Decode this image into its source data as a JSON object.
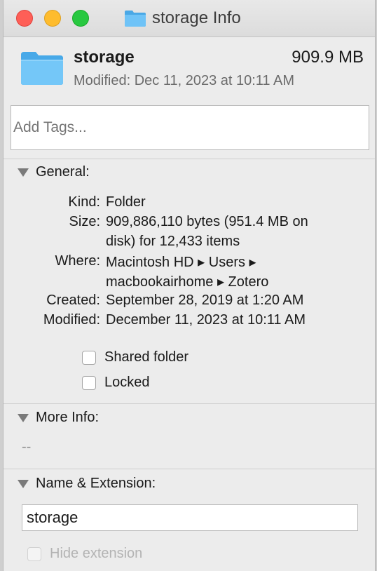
{
  "window": {
    "title": "storage Info"
  },
  "header": {
    "name": "storage",
    "size": "909.9 MB",
    "modified": "Modified: Dec 11, 2023 at 10:11 AM"
  },
  "tags": {
    "placeholder": "Add Tags..."
  },
  "general": {
    "title": "General:",
    "rows": [
      {
        "label": "Kind:",
        "value": "Folder"
      },
      {
        "label": "Size:",
        "value": "909,886,110 bytes (951.4 MB on",
        "value2": "disk) for 12,433 items"
      },
      {
        "label": "Where:",
        "value": "Macintosh HD ▸ Users ▸",
        "value2": "macbookairhome ▸ Zotero"
      },
      {
        "label": "Created:",
        "value": "September 28, 2019 at 1:20 AM"
      },
      {
        "label": "Modified:",
        "value": "December 11, 2023 at 10:11 AM"
      }
    ],
    "shared_folder_label": "Shared folder",
    "locked_label": "Locked"
  },
  "more_info": {
    "title": "More Info:",
    "value": "--"
  },
  "name_extension": {
    "title": "Name & Extension:",
    "name_value": "storage",
    "hide_extension_label": "Hide extension"
  },
  "colors": {
    "folder": "#5ac8fa",
    "close": "#fe5f57",
    "minimize": "#febc2e",
    "zoom": "#28c840"
  },
  "icons": {
    "folder": "folder-icon",
    "disclosure": "disclosure-triangle-icon"
  }
}
